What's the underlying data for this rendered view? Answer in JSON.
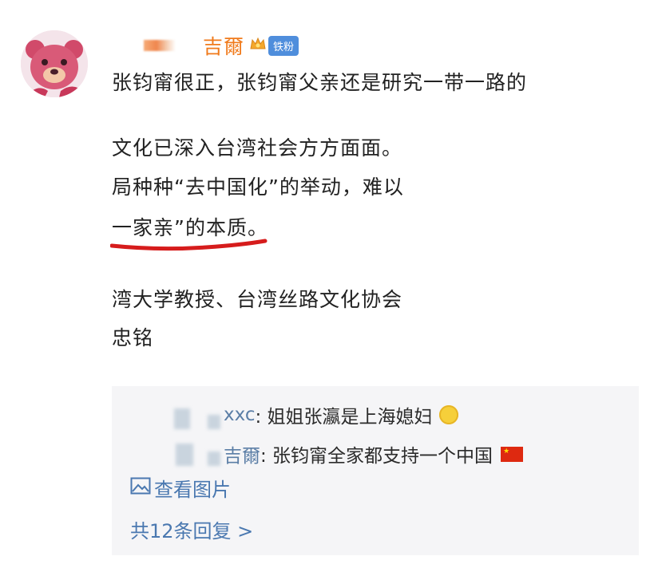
{
  "post": {
    "username": "吉爾",
    "badge": "铁粉",
    "lines": [
      "张钧甯很正，张钧甯父亲还是研究一带一路的",
      "文化已深入台湾社会方方面面。",
      "局种种“去中国化”的举动，难以",
      "一家亲”的本质。",
      "湾大学教授、台湾丝路文化协会",
      "忠铭"
    ]
  },
  "replies": {
    "items": [
      {
        "name": "xxc",
        "text": ": 姐姐张瀛是上海媳妇"
      },
      {
        "name": "吉爾",
        "text": ": 张钧甯全家都支持一个中国"
      }
    ],
    "view_images": "查看图片",
    "reply_count": "共12条回复 >"
  },
  "colors": {
    "username": "#f07a1b",
    "link": "#4a78b0",
    "underline": "#d61c1c",
    "reply_bg": "#f5f5f7"
  }
}
